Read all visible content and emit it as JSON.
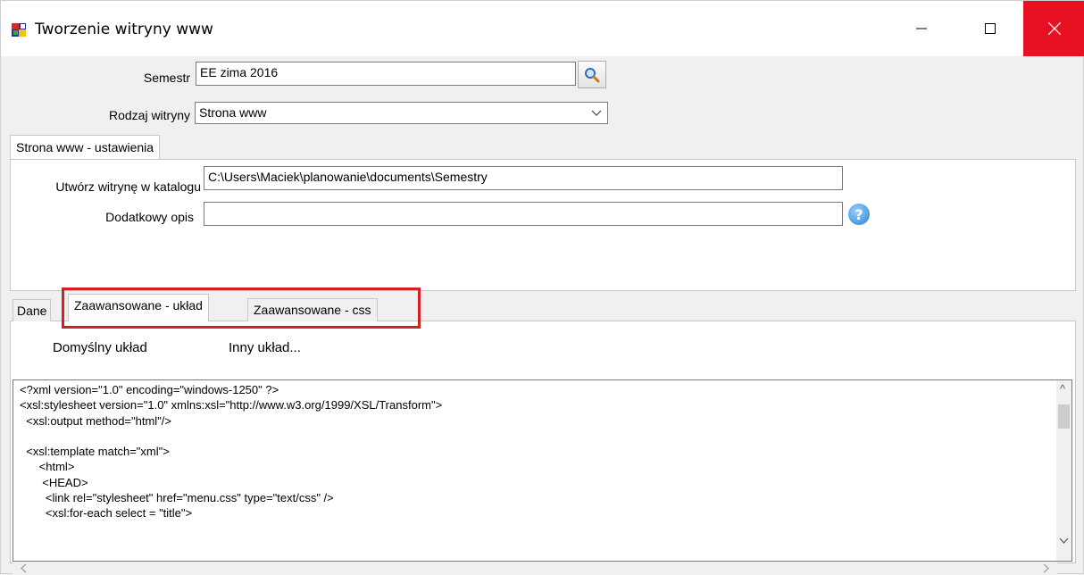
{
  "window": {
    "title": "Tworzenie witryny www"
  },
  "form": {
    "semester_label": "Semestr",
    "semester_value": "EE zima 2016",
    "site_type_label": "Rodzaj witryny",
    "site_type_value": "Strona www"
  },
  "settings_tab": {
    "label": "Strona www - ustawienia"
  },
  "settings": {
    "dir_label": "Utwórz witrynę w katalogu",
    "dir_value": "C:\\Users\\Maciek\\planowanie\\documents\\Semestry",
    "desc_label": "Dodatkowy opis",
    "desc_value": ""
  },
  "tabs": [
    {
      "label": "Dane"
    },
    {
      "label": "Zaawansowane - układ"
    },
    {
      "label": "Zaawansowane - css"
    }
  ],
  "layout": {
    "default_label": "Domyślny układ",
    "other_label": "Inny układ..."
  },
  "code_text": "<?xml version=\"1.0\" encoding=\"windows-1250\" ?>\n<xsl:stylesheet version=\"1.0\" xmlns:xsl=\"http://www.w3.org/1999/XSL/Transform\">\n  <xsl:output method=\"html\"/>\n\n  <xsl:template match=\"xml\">\n      <html>\n       <HEAD>\n        <link rel=\"stylesheet\" href=\"menu.css\" type=\"text/css\" />\n        <xsl:for-each select = \"title\">",
  "colors": {
    "close_button": "#e81123",
    "highlight": "#d32020",
    "help_icon": "#2a7fd6"
  }
}
